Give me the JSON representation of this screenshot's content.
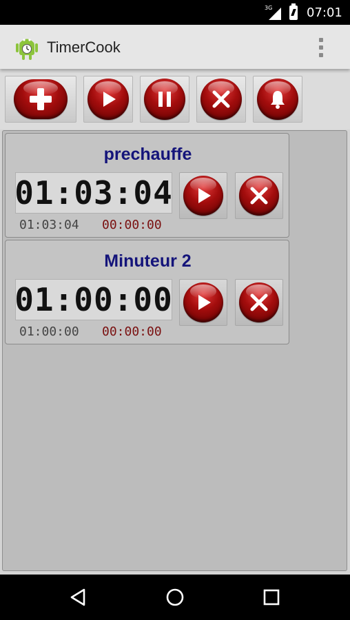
{
  "status_bar": {
    "network": "3G",
    "time": "07:01"
  },
  "app_bar": {
    "title": "TimerCook"
  },
  "toolbar": {
    "buttons": [
      {
        "name": "add-timer-button",
        "icon": "plus-icon"
      },
      {
        "name": "start-all-button",
        "icon": "play-icon"
      },
      {
        "name": "pause-all-button",
        "icon": "pause-icon"
      },
      {
        "name": "cancel-all-button",
        "icon": "close-icon"
      },
      {
        "name": "alarm-button",
        "icon": "bell-icon"
      }
    ]
  },
  "timers": [
    {
      "title": "prechauffe",
      "display": "01:03:04",
      "total": "01:03:04",
      "elapsed": "00:00:00"
    },
    {
      "title": "Minuteur 2",
      "display": "01:00:00",
      "total": "01:00:00",
      "elapsed": "00:00:00"
    }
  ],
  "colors": {
    "accent_red": "#a30d0d",
    "title_blue": "#14147a",
    "elapsed_red": "#7a1010"
  },
  "nav_bar": {
    "icons": [
      "back-icon",
      "home-icon",
      "recents-icon"
    ]
  }
}
